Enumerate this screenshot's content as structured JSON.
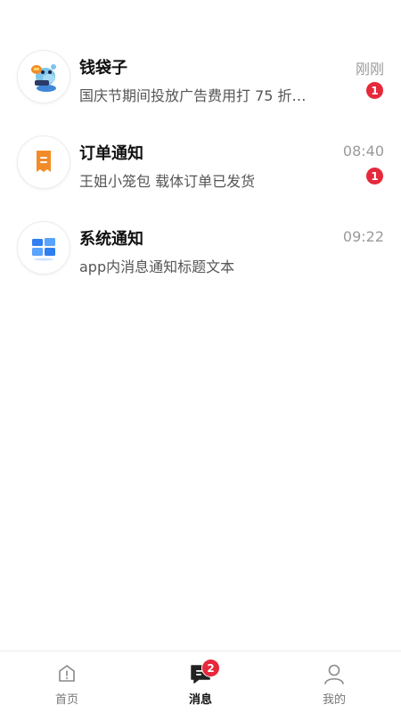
{
  "messages": [
    {
      "title": "钱袋子",
      "time": "刚刚",
      "preview": "国庆节期间投放广告费用打 75 折…",
      "badge": "1",
      "icon": "mascot-hippo-icon"
    },
    {
      "title": "订单通知",
      "time": "08:40",
      "preview": "王姐小笼包 载体订单已发货",
      "badge": "1",
      "icon": "receipt-icon"
    },
    {
      "title": "系统通知",
      "time": "09:22",
      "preview": "app内消息通知标题文本",
      "icon": "windows-grid-icon"
    }
  ],
  "tabbar": {
    "items": [
      {
        "label": "首页",
        "icon": "home-icon",
        "active": false
      },
      {
        "label": "消息",
        "icon": "message-icon",
        "active": true,
        "badge": "2"
      },
      {
        "label": "我的",
        "icon": "profile-icon",
        "active": false
      }
    ]
  },
  "colors": {
    "badge": "#e5293b",
    "accent_orange": "#f28c28",
    "accent_blue": "#2f7ff0"
  }
}
